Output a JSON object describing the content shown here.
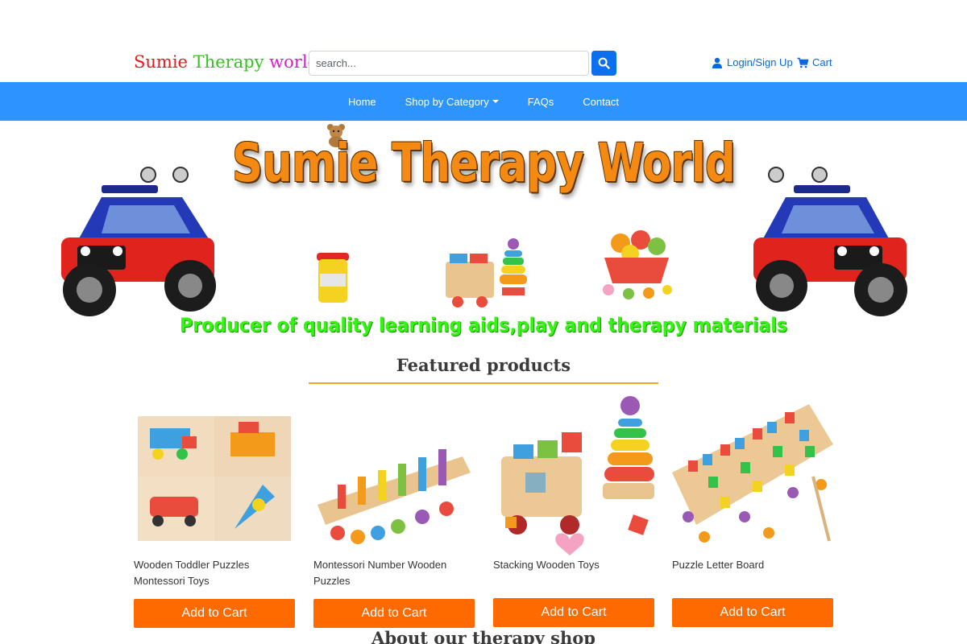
{
  "header": {
    "logo": {
      "word1": "Sumie",
      "word2": "Therapy",
      "word3": "world"
    },
    "search_placeholder": "search...",
    "login_label": "Login/Sign Up",
    "cart_label": "Cart"
  },
  "nav": {
    "items": [
      {
        "label": "Home"
      },
      {
        "label": "Shop by Category"
      },
      {
        "label": "FAQs"
      },
      {
        "label": "Contact"
      }
    ]
  },
  "banner": {
    "title": "Sumie Therapy World",
    "tagline": "Producer of quality learning aids,play and therapy materials"
  },
  "featured": {
    "title": "Featured products",
    "products": [
      {
        "name": "Wooden Toddler Puzzles Montessori Toys",
        "button": "Add to Cart"
      },
      {
        "name": "Montessori Number Wooden Puzzles",
        "button": "Add to Cart"
      },
      {
        "name": "Stacking Wooden Toys",
        "button": "Add to Cart"
      },
      {
        "name": "Puzzle Letter Board",
        "button": "Add to Cart"
      }
    ]
  },
  "about": {
    "title": "About our therapy shop"
  },
  "colors": {
    "accent": "#0b6ff0",
    "nav_bg": "#2d93ff",
    "button": "#ff6a00",
    "banner_title": "#f58a12",
    "tagline": "#34f50f"
  },
  "icons": [
    "search-icon",
    "user-icon",
    "cart-icon",
    "chevron-down-icon"
  ]
}
